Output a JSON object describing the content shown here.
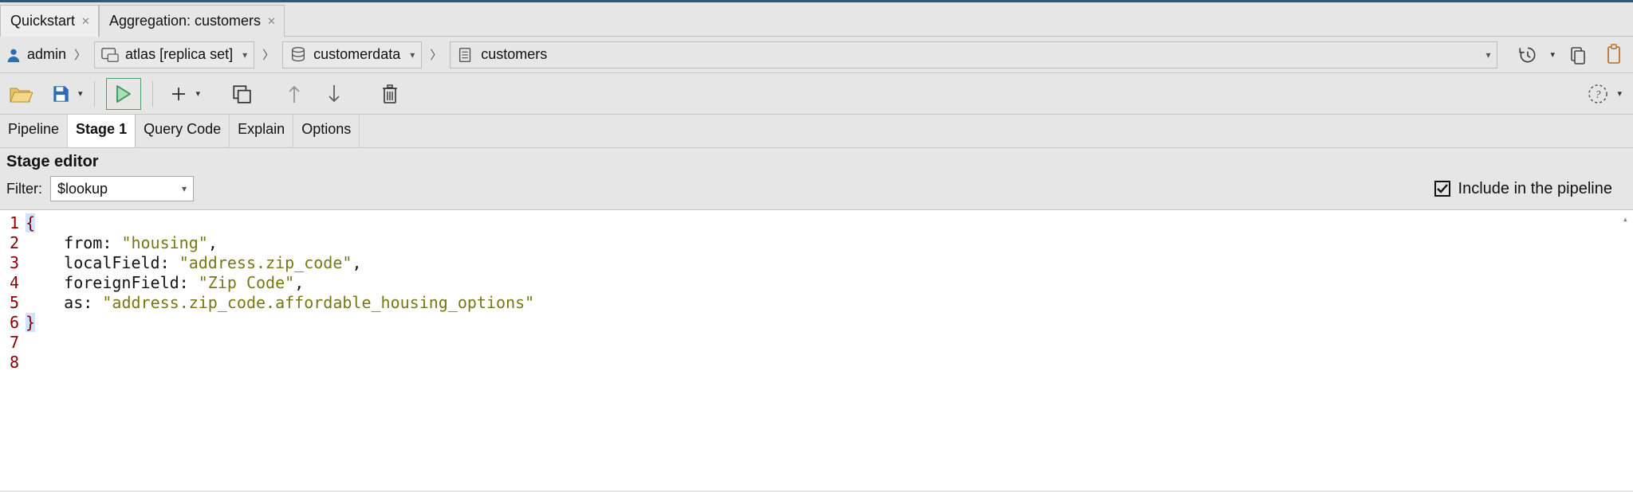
{
  "window_tabs": [
    {
      "label": "Quickstart",
      "active": false
    },
    {
      "label": "Aggregation: customers",
      "active": true
    }
  ],
  "breadcrumb": {
    "user": "admin",
    "cluster": "atlas [replica set]",
    "database": "customerdata",
    "collection": "customers"
  },
  "sub_tabs": [
    "Pipeline",
    "Stage 1",
    "Query Code",
    "Explain",
    "Options"
  ],
  "active_sub_tab": "Stage 1",
  "stage_editor": {
    "heading": "Stage editor",
    "filter_label": "Filter:",
    "filter_value": "$lookup",
    "include_label": "Include in the pipeline",
    "include_checked": true
  },
  "code": {
    "lines": [
      {
        "n": 1,
        "tokens": [
          {
            "t": "{",
            "c": "brace",
            "hl": true
          }
        ]
      },
      {
        "n": 2,
        "tokens": [
          {
            "t": "    ",
            "c": "plain"
          },
          {
            "t": "from",
            "c": "key"
          },
          {
            "t": ": ",
            "c": "punc"
          },
          {
            "t": "\"housing\"",
            "c": "str"
          },
          {
            "t": ",",
            "c": "punc"
          }
        ]
      },
      {
        "n": 3,
        "tokens": [
          {
            "t": "    ",
            "c": "plain"
          },
          {
            "t": "localField",
            "c": "key"
          },
          {
            "t": ": ",
            "c": "punc"
          },
          {
            "t": "\"address.zip_code\"",
            "c": "str"
          },
          {
            "t": ",",
            "c": "punc"
          }
        ]
      },
      {
        "n": 4,
        "tokens": [
          {
            "t": "    ",
            "c": "plain"
          },
          {
            "t": "foreignField",
            "c": "key"
          },
          {
            "t": ": ",
            "c": "punc"
          },
          {
            "t": "\"Zip Code\"",
            "c": "str"
          },
          {
            "t": ",",
            "c": "punc"
          }
        ]
      },
      {
        "n": 5,
        "tokens": [
          {
            "t": "    ",
            "c": "plain"
          },
          {
            "t": "as",
            "c": "key"
          },
          {
            "t": ": ",
            "c": "punc"
          },
          {
            "t": "\"address.zip_code.affordable_housing_options\"",
            "c": "str"
          }
        ]
      },
      {
        "n": 6,
        "tokens": [
          {
            "t": "}",
            "c": "brace",
            "hl": true
          }
        ]
      },
      {
        "n": 7,
        "tokens": []
      },
      {
        "n": 8,
        "tokens": []
      }
    ]
  }
}
